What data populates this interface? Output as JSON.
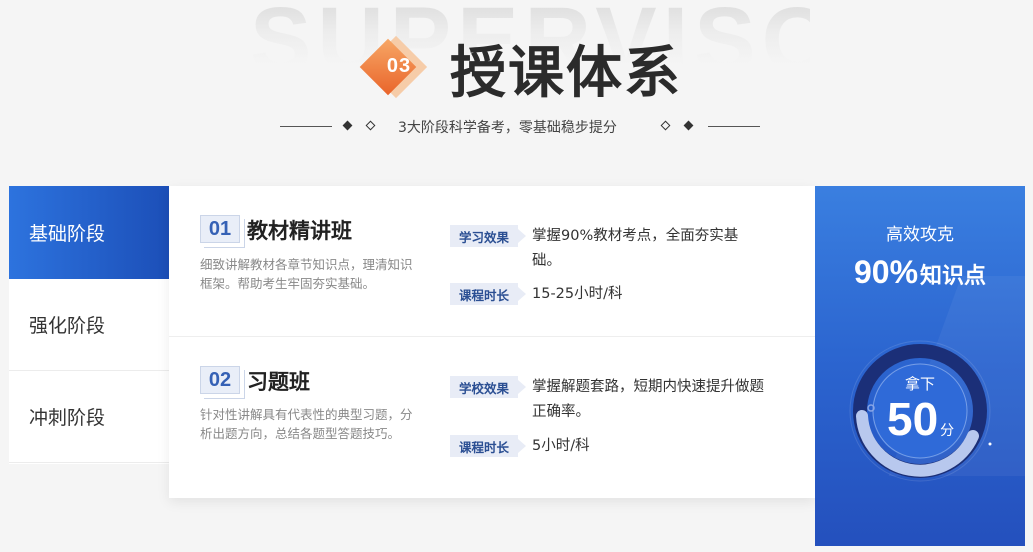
{
  "header": {
    "bg_word": "SUPERVISOR",
    "badge": "03",
    "title": "授课体系",
    "subtitle": "3大阶段科学备考，零基础稳步提分"
  },
  "tabs": [
    {
      "label": "基础阶段",
      "active": true
    },
    {
      "label": "强化阶段",
      "active": false
    },
    {
      "label": "冲刺阶段",
      "active": false
    }
  ],
  "courses": [
    {
      "number": "01",
      "name": "教材精讲班",
      "desc": "细致讲解教材各章节知识点，理清知识框架。帮助考生牢固夯实基础。",
      "tag1": "学习效果",
      "val1": "掌握90%教材考点，全面夯实基础。",
      "tag2": "课程时长",
      "val2": "15-25小时/科"
    },
    {
      "number": "02",
      "name": "习题班",
      "desc": "针对性讲解具有代表性的典型习题，分析出题方向，总结各题型答题技巧。",
      "tag1": "学校效果",
      "val1": "掌握解题套路，短期内快速提升做题正确率。",
      "tag2": "课程时长",
      "val2": "5小时/科"
    }
  ],
  "panel": {
    "top": "高效攻克",
    "percent": "90%",
    "percent_unit": "知识点",
    "gauge_label": "拿下",
    "gauge_value": "50",
    "gauge_unit": "分"
  },
  "colors": {
    "accent_blue": "#2d73de",
    "badge_orange": "#e9642a"
  }
}
